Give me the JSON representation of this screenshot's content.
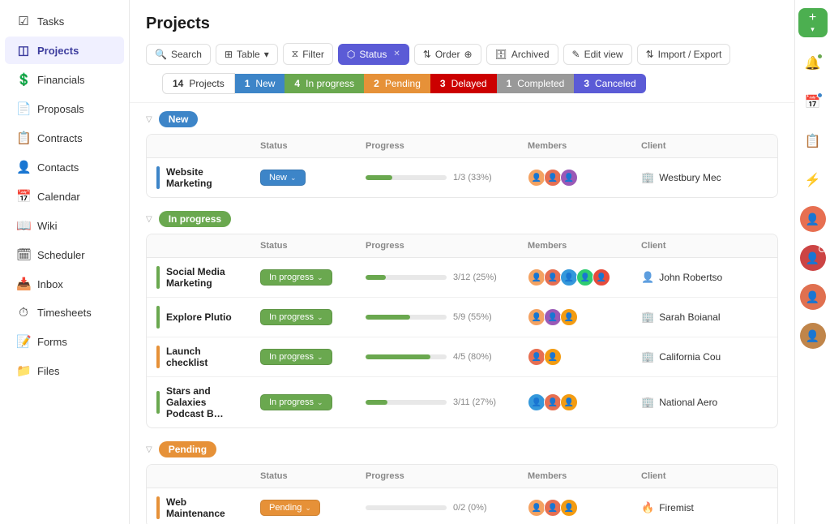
{
  "sidebar": {
    "items": [
      {
        "id": "tasks",
        "label": "Tasks",
        "icon": "☑"
      },
      {
        "id": "projects",
        "label": "Projects",
        "icon": "◫"
      },
      {
        "id": "financials",
        "label": "Financials",
        "icon": "💲"
      },
      {
        "id": "proposals",
        "label": "Proposals",
        "icon": "📄"
      },
      {
        "id": "contracts",
        "label": "Contracts",
        "icon": "📋"
      },
      {
        "id": "contacts",
        "label": "Contacts",
        "icon": "👤"
      },
      {
        "id": "calendar",
        "label": "Calendar",
        "icon": "📅"
      },
      {
        "id": "wiki",
        "label": "Wiki",
        "icon": "📖"
      },
      {
        "id": "scheduler",
        "label": "Scheduler",
        "icon": "🗓"
      },
      {
        "id": "inbox",
        "label": "Inbox",
        "icon": "📥"
      },
      {
        "id": "timesheets",
        "label": "Timesheets",
        "icon": "⏱"
      },
      {
        "id": "forms",
        "label": "Forms",
        "icon": "📝"
      },
      {
        "id": "files",
        "label": "Files",
        "icon": "📁"
      }
    ]
  },
  "page": {
    "title": "Projects"
  },
  "toolbar": {
    "search_placeholder": "Search",
    "table_label": "Table",
    "filter_label": "Filter",
    "status_label": "Status",
    "order_label": "Order",
    "archived_label": "Archived",
    "edit_view_label": "Edit view",
    "import_export_label": "Import / Export"
  },
  "status_tabs": [
    {
      "id": "all",
      "count": "14",
      "label": "Projects",
      "type": "all"
    },
    {
      "id": "new",
      "count": "1",
      "label": "New",
      "type": "new"
    },
    {
      "id": "inprogress",
      "count": "4",
      "label": "In progress",
      "type": "inprogress"
    },
    {
      "id": "pending",
      "count": "2",
      "label": "Pending",
      "type": "pending"
    },
    {
      "id": "delayed",
      "count": "3",
      "label": "Delayed",
      "type": "delayed"
    },
    {
      "id": "completed",
      "count": "1",
      "label": "Completed",
      "type": "completed"
    },
    {
      "id": "canceled",
      "count": "3",
      "label": "Canceled",
      "type": "canceled"
    }
  ],
  "sections": [
    {
      "id": "new",
      "label": "New",
      "type": "new",
      "columns": [
        "",
        "Status",
        "Progress",
        "Members",
        "Client"
      ],
      "rows": [
        {
          "name": "Website Marketing",
          "status": "New",
          "status_type": "new",
          "progress_pct": 33,
          "progress_fill": 33,
          "progress_label": "1/3 (33%)",
          "members": [
            "av1",
            "av2",
            "av3"
          ],
          "client": "Westbury Mec",
          "client_icon": "🏢",
          "bar_class": "bar-blue"
        }
      ]
    },
    {
      "id": "inprogress",
      "label": "In progress",
      "type": "inprogress",
      "columns": [
        "",
        "Status",
        "Progress",
        "Members",
        "Client"
      ],
      "rows": [
        {
          "name": "Social Media Marketing",
          "status": "In progress",
          "status_type": "inprogress",
          "progress_pct": 25,
          "progress_fill": 25,
          "progress_label": "3/12 (25%)",
          "members": [
            "av1",
            "av2",
            "av4",
            "av5",
            "av6"
          ],
          "client": "John Robertso",
          "client_icon": "👤",
          "bar_class": "bar-green"
        },
        {
          "name": "Explore Plutio",
          "status": "In progress",
          "status_type": "inprogress",
          "progress_pct": 55,
          "progress_fill": 55,
          "progress_label": "5/9 (55%)",
          "members": [
            "av1",
            "av3",
            "av7"
          ],
          "client": "Sarah Boianal",
          "client_icon": "🏢",
          "bar_class": "bar-green"
        },
        {
          "name": "Launch checklist",
          "status": "In progress",
          "status_type": "inprogress",
          "progress_pct": 80,
          "progress_fill": 80,
          "progress_label": "4/5 (80%)",
          "members": [
            "av2",
            "av7"
          ],
          "client": "California Cou",
          "client_icon": "🏢",
          "bar_class": "bar-orange"
        },
        {
          "name": "Stars and Galaxies Podcast B…",
          "status": "In progress",
          "status_type": "inprogress",
          "progress_pct": 27,
          "progress_fill": 27,
          "progress_label": "3/11 (27%)",
          "members": [
            "av4",
            "av2",
            "av7"
          ],
          "client": "National Aero",
          "client_icon": "🏢",
          "bar_class": "bar-green"
        }
      ]
    },
    {
      "id": "pending",
      "label": "Pending",
      "type": "pending",
      "columns": [
        "",
        "Status",
        "Progress",
        "Members",
        "Client"
      ],
      "rows": [
        {
          "name": "Web Maintenance",
          "status": "Pending",
          "status_type": "pending",
          "progress_pct": 0,
          "progress_fill": 0,
          "progress_label": "0/2 (0%)",
          "members": [
            "av1",
            "av2",
            "av7"
          ],
          "client": "Firemist",
          "client_icon": "🔥",
          "bar_class": "bar-orange"
        }
      ]
    }
  ],
  "right_panel": {
    "icons": [
      "🔔",
      "📅",
      "📋",
      "⚡"
    ]
  }
}
